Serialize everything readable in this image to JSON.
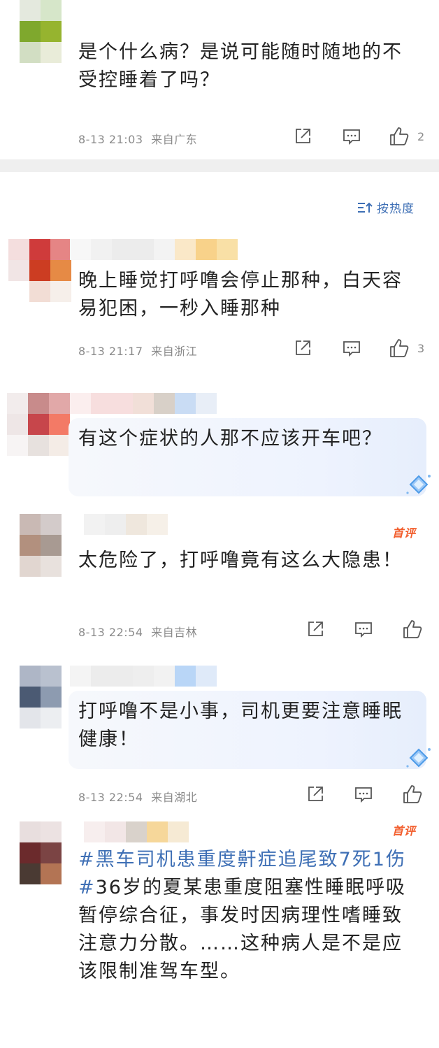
{
  "sort": {
    "icon": "sort-icon",
    "label": "按热度"
  },
  "comments": [
    {
      "text": "是个什么病？是说可能随时随地的不受控睡着了吗？",
      "time": "8-13 21:03",
      "location": "来自广东",
      "likes": "2"
    },
    {
      "text": "晚上睡觉打呼噜会停止那种，白天容易犯困，一秒入睡那种",
      "time": "8-13 21:17",
      "location": "来自浙江",
      "likes": "3"
    },
    {
      "text": "有这个症状的人那不应该开车吧？",
      "reply": true
    },
    {
      "text": "太危险了，打呼噜竟有这么大隐患！",
      "badge": "首评",
      "time": "8-13 22:54",
      "location": "来自吉林",
      "likes": ""
    },
    {
      "text": "打呼噜不是小事，司机更要注意睡眠健康！",
      "reply": true
    },
    {
      "time": "8-13 22:54",
      "location": "来自湖北"
    },
    {
      "badge": "首评",
      "hashtag": "#黑车司机患重度鼾症追尾致7死1伤#",
      "text": "36岁的夏某患重度阻塞性睡眠呼吸暂停综合征，事发时因病理性嗜睡致注意力分散。……这种病人是不是应该限制准驾车型。"
    }
  ],
  "icons": {
    "share": "share-icon",
    "comment": "comment-icon",
    "like": "like-icon",
    "diamond": "diamond-badge-icon"
  },
  "colors": {
    "accent_blue": "#3e6fb5",
    "badge_orange": "#f25d2c",
    "meta_gray": "#8a8a8a"
  }
}
